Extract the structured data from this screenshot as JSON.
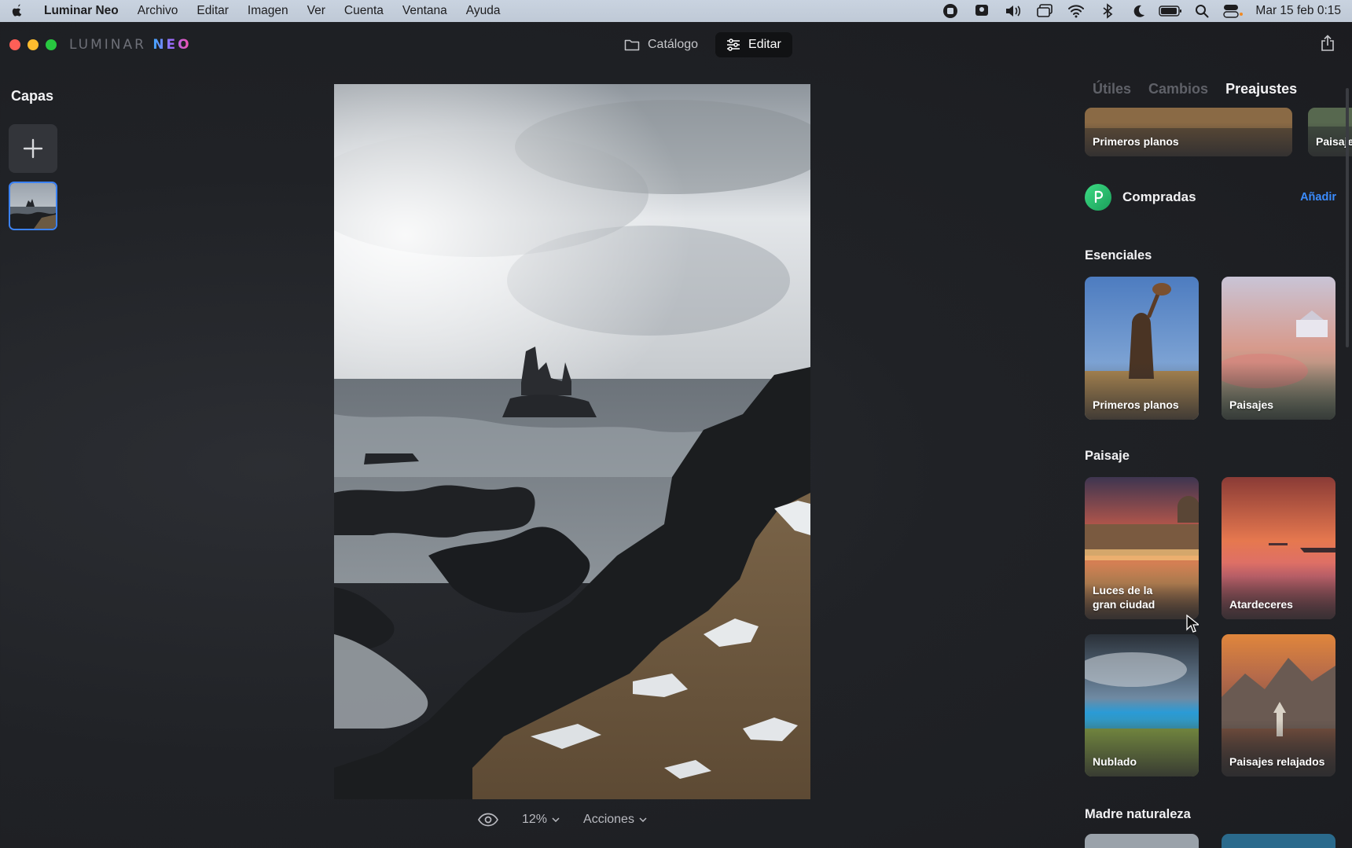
{
  "menubar": {
    "app_name": "Luminar Neo",
    "menus": [
      "Archivo",
      "Editar",
      "Imagen",
      "Ver",
      "Cuenta",
      "Ventana",
      "Ayuda"
    ],
    "clock": "Mar 15 feb  0:15",
    "status_icons": [
      "record-icon",
      "display-icon",
      "volume-icon",
      "screen-mirror-icon",
      "wifi-icon",
      "bluetooth-icon",
      "moon-icon",
      "battery-icon",
      "search-icon",
      "control-center-icon"
    ]
  },
  "window": {
    "brand_prefix": "LUMINAR",
    "brand_suffix": "NEO",
    "modes": {
      "catalog": "Catálogo",
      "edit": "Editar"
    }
  },
  "layers": {
    "title": "Capas"
  },
  "canvas": {
    "zoom": "12%",
    "actions": "Acciones"
  },
  "presets": {
    "tabs": [
      "Útiles",
      "Cambios",
      "Preajustes"
    ],
    "active_tab": "Preajustes",
    "top_row": [
      "Primeros planos",
      "Paisaje"
    ],
    "purchased": {
      "label": "Compradas",
      "add": "Añadir"
    },
    "sections": [
      {
        "title": "Esenciales",
        "items": [
          "Primeros planos",
          "Paisajes"
        ]
      },
      {
        "title": "Paisaje",
        "items": [
          "Luces de la gran ciudad",
          "Atardeceres",
          "Nublado",
          "Paisajes relajados"
        ]
      },
      {
        "title": "Madre naturaleza",
        "items": []
      }
    ]
  },
  "colors": {
    "accent_blue": "#3b8cff",
    "selection_blue": "#3b82f6",
    "panel_bg": "#1f2024"
  }
}
